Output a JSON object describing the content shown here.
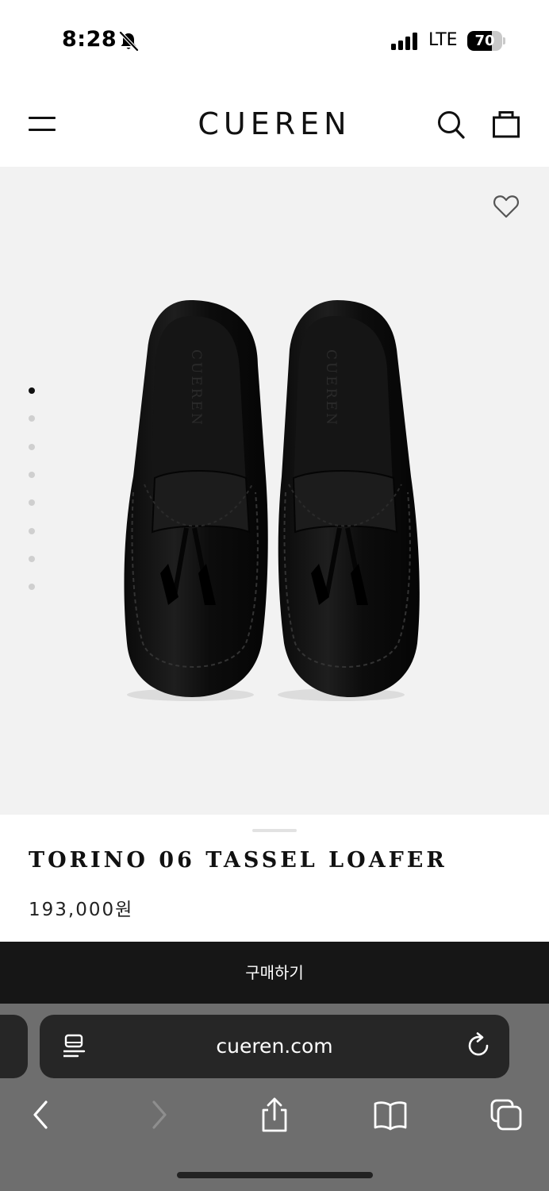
{
  "status_bar": {
    "time": "8:28",
    "network": "LTE",
    "battery_percent": 70,
    "battery_label": "70"
  },
  "header": {
    "brand": "CUEREN",
    "menu_icon": "hamburger-menu-icon",
    "search_icon": "search-icon",
    "cart_icon": "shopping-bag-icon"
  },
  "gallery": {
    "wishlist_icon": "heart-icon",
    "image_count": 8,
    "active_index": 0,
    "image_text": "CUEREN"
  },
  "product": {
    "title": "TORINO 06 TASSEL LOAFER",
    "price": "193,000원"
  },
  "buy_button": {
    "label": "구매하기"
  },
  "browser": {
    "url": "cueren.com",
    "reader_icon": "page-menu-icon",
    "reload_icon": "reload-icon",
    "toolbar": [
      "back-icon",
      "forward-icon",
      "share-icon",
      "bookmarks-icon",
      "tabs-icon"
    ]
  },
  "colors": {
    "buy_button_bg": "#161616",
    "media_bg": "#f2f2f2",
    "browser_bg": "#6e6e6e",
    "url_bar_bg": "#262626"
  }
}
